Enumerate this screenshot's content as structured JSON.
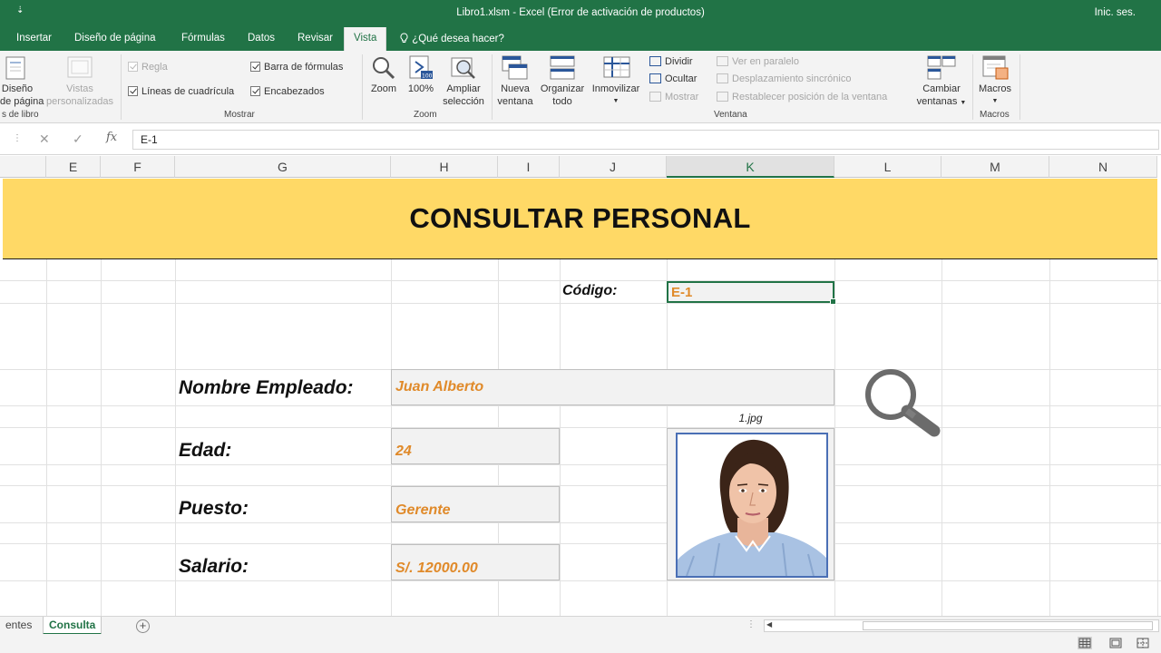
{
  "window": {
    "quick_access": "⇣",
    "title": "Libro1.xlsm  -  Excel (Error de activación de productos)",
    "signin": "Inic. ses."
  },
  "tabs": [
    "Insertar",
    "Diseño de página",
    "Fórmulas",
    "Datos",
    "Revisar",
    "Vista"
  ],
  "active_tab": "Vista",
  "tell_me": "¿Qué desea hacer?",
  "ribbon": {
    "book_views": {
      "page_layout": [
        "Diseño",
        "de página"
      ],
      "custom_views": [
        "Vistas",
        "personalizadas"
      ],
      "group": "s de libro"
    },
    "show": {
      "group": "Mostrar",
      "ruler": "Regla",
      "gridlines": "Líneas de cuadrícula",
      "formula_bar": "Barra de fórmulas",
      "headings": "Encabezados"
    },
    "zoom": {
      "group": "Zoom",
      "zoom": "Zoom",
      "hundred": "100%",
      "selection": [
        "Ampliar",
        "selección"
      ]
    },
    "window": {
      "group": "Ventana",
      "new_window": [
        "Nueva",
        "ventana"
      ],
      "arrange": [
        "Organizar",
        "todo"
      ],
      "freeze": "Inmovilizar",
      "split": "Dividir",
      "hide": "Ocultar",
      "unhide": "Mostrar",
      "side_by_side": "Ver en paralelo",
      "sync_scroll": "Desplazamiento sincrónico",
      "reset_position": "Restablecer posición de la ventana",
      "switch": [
        "Cambiar",
        "ventanas"
      ]
    },
    "macros": {
      "group": "Macros",
      "macros": "Macros"
    }
  },
  "formula_bar": {
    "cancel": "✕",
    "enter": "✓",
    "fx": "fx",
    "value": "E-1"
  },
  "columns": [
    "E",
    "F",
    "G",
    "H",
    "I",
    "J",
    "K",
    "L",
    "M",
    "N"
  ],
  "selected_column": "K",
  "sheet": {
    "banner_title": "CONSULTAR PERSONAL",
    "code_label": "Código:",
    "code_value": "E-1",
    "name_label": "Nombre Empleado:",
    "name_value": "Juan Alberto",
    "age_label": "Edad:",
    "age_value": "24",
    "position_label": "Puesto:",
    "position_value": "Gerente",
    "salary_label": "Salario:",
    "salary_value": "S/. 12000.00",
    "photo_filename": "1.jpg",
    "search_icon": "magnifier-icon"
  },
  "sheet_tabs": [
    "entes",
    "Consulta"
  ],
  "active_sheet": "Consulta",
  "colors": {
    "excel_green": "#217346",
    "banner_yellow": "#ffd966",
    "value_orange": "#e08a2a"
  }
}
